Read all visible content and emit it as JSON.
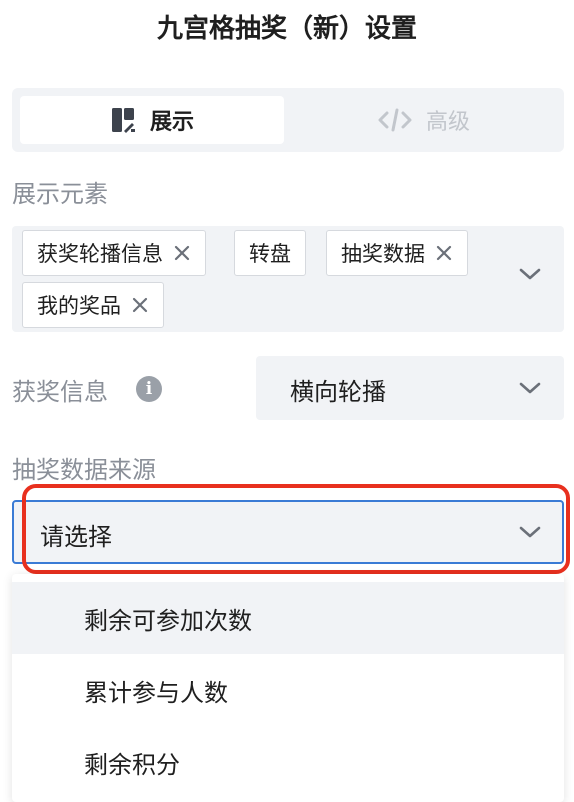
{
  "title": "九宫格抽奖（新）设置",
  "tabs": [
    {
      "label": "展示",
      "icon": "layout-icon",
      "active": true
    },
    {
      "label": "高级",
      "icon": "code-icon",
      "active": false
    }
  ],
  "display_elements": {
    "label": "展示元素",
    "tags": [
      {
        "label": "获奖轮播信息",
        "removable": true
      },
      {
        "label": "转盘",
        "removable": false
      },
      {
        "label": "抽奖数据",
        "removable": true
      },
      {
        "label": "我的奖品",
        "removable": true
      }
    ]
  },
  "winner_info": {
    "label": "获奖信息",
    "value": "横向轮播"
  },
  "data_source": {
    "label": "抽奖数据来源",
    "placeholder": "请选择",
    "options": [
      "剩余可参加次数",
      "累计参与人数",
      "剩余积分"
    ]
  },
  "colors": {
    "accent": "#3a7bd5",
    "highlight": "#e8301e",
    "panel_bg": "#f1f3f6"
  }
}
